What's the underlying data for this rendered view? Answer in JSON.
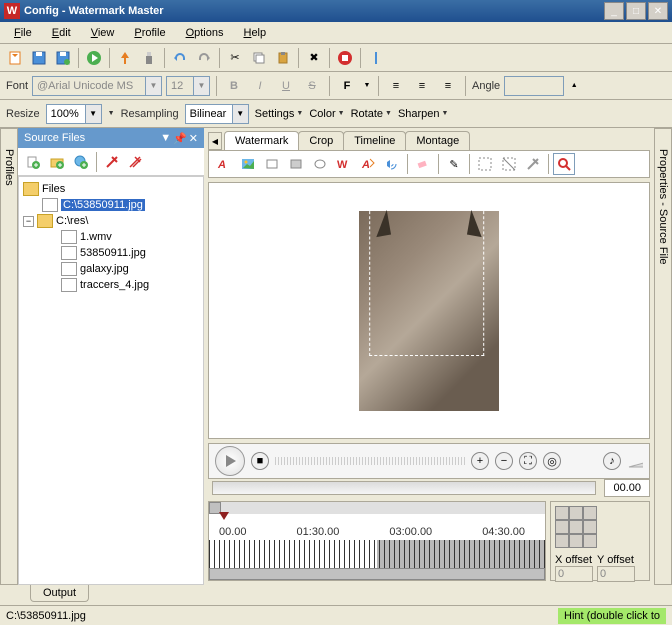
{
  "window": {
    "title": "Config - Watermark Master"
  },
  "menu": {
    "file": "File",
    "edit": "Edit",
    "view": "View",
    "profile": "Profile",
    "options": "Options",
    "help": "Help"
  },
  "font_toolbar": {
    "label": "Font",
    "fontname": "@Arial Unicode MS",
    "fontsize": "12",
    "angle_label": "Angle",
    "angle_value": ""
  },
  "resize_toolbar": {
    "resize": "Resize",
    "zoom": "100%",
    "resampling": "Resampling",
    "method": "Bilinear",
    "settings": "Settings",
    "color": "Color",
    "rotate": "Rotate",
    "sharpen": "Sharpen"
  },
  "side_left": "Profiles",
  "side_right": "Properties - Source File",
  "source_panel": {
    "title": "Source Files",
    "root": "Files",
    "selected": "C:\\53850911.jpg",
    "folder": "C:\\res\\",
    "items": [
      "1.wmv",
      "53850911.jpg",
      "galaxy.jpg",
      "traccers_4.jpg"
    ]
  },
  "tabs": {
    "watermark": "Watermark",
    "crop": "Crop",
    "timeline": "Timeline",
    "montage": "Montage"
  },
  "player": {
    "time": "00.00"
  },
  "timeline": {
    "t0": "00.00",
    "t1": "01:30.00",
    "t2": "03:00.00",
    "t3": "04:30.00"
  },
  "offsets": {
    "x_label": "X offset",
    "y_label": "Y offset",
    "x": "0",
    "y": "0"
  },
  "output_tab": "Output",
  "status": {
    "path": "C:\\53850911.jpg",
    "hint": "Hint (double click to"
  }
}
